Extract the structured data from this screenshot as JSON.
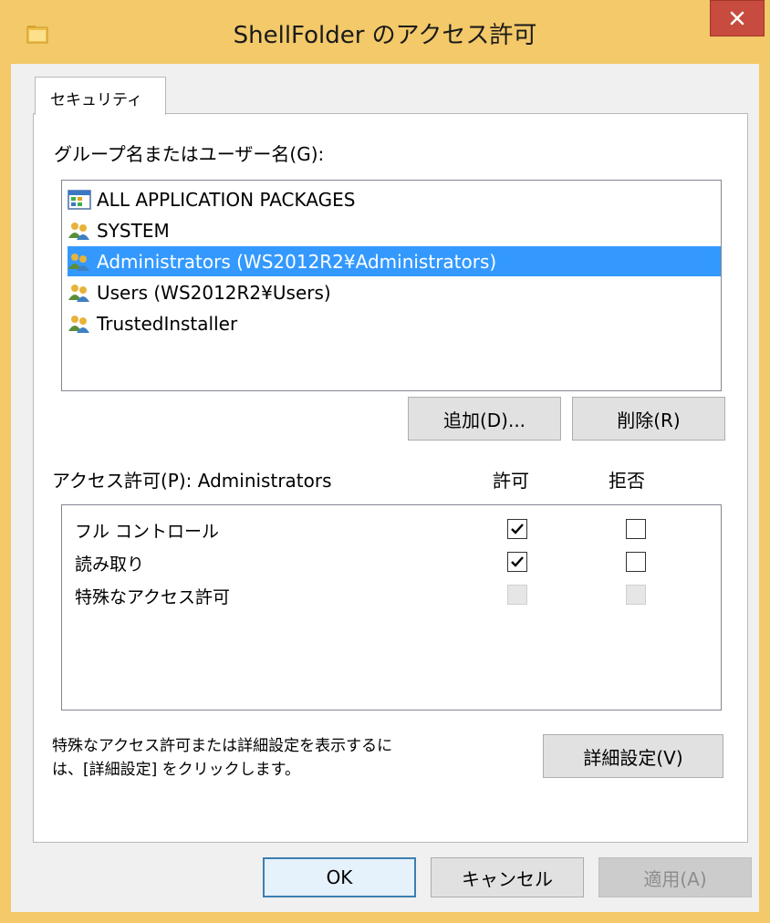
{
  "window": {
    "title": "ShellFolder のアクセス許可",
    "close_glyph": "✕"
  },
  "tab": {
    "label": "セキュリティ"
  },
  "groups": {
    "label": "グループ名またはユーザー名(G):",
    "items": [
      {
        "label": "ALL APPLICATION PACKAGES",
        "icon": "app-packages-icon",
        "selected": false
      },
      {
        "label": "SYSTEM",
        "icon": "user-group-icon",
        "selected": false
      },
      {
        "label": "Administrators (WS2012R2¥Administrators)",
        "icon": "user-group-icon",
        "selected": true
      },
      {
        "label": "Users (WS2012R2¥Users)",
        "icon": "user-group-icon",
        "selected": false
      },
      {
        "label": "TrustedInstaller",
        "icon": "user-group-icon",
        "selected": false
      }
    ],
    "add_button": "追加(D)...",
    "remove_button": "削除(R)"
  },
  "permissions": {
    "label": "アクセス許可(P): Administrators",
    "allow_header": "許可",
    "deny_header": "拒否",
    "rows": [
      {
        "label": "フル コントロール",
        "allow": true,
        "deny": false,
        "disabled": false
      },
      {
        "label": "読み取り",
        "allow": true,
        "deny": false,
        "disabled": false
      },
      {
        "label": "特殊なアクセス許可",
        "allow": false,
        "deny": false,
        "disabled": true
      }
    ]
  },
  "advanced": {
    "text_line1": "特殊なアクセス許可または詳細設定を表示するに",
    "text_line2": "は、[詳細設定] をクリックします。",
    "button": "詳細設定(V)"
  },
  "footer": {
    "ok": "OK",
    "cancel": "キャンセル",
    "apply": "適用(A)"
  },
  "colors": {
    "frame": "#f3c969",
    "selection": "#3399ff",
    "close": "#c74b3e"
  }
}
